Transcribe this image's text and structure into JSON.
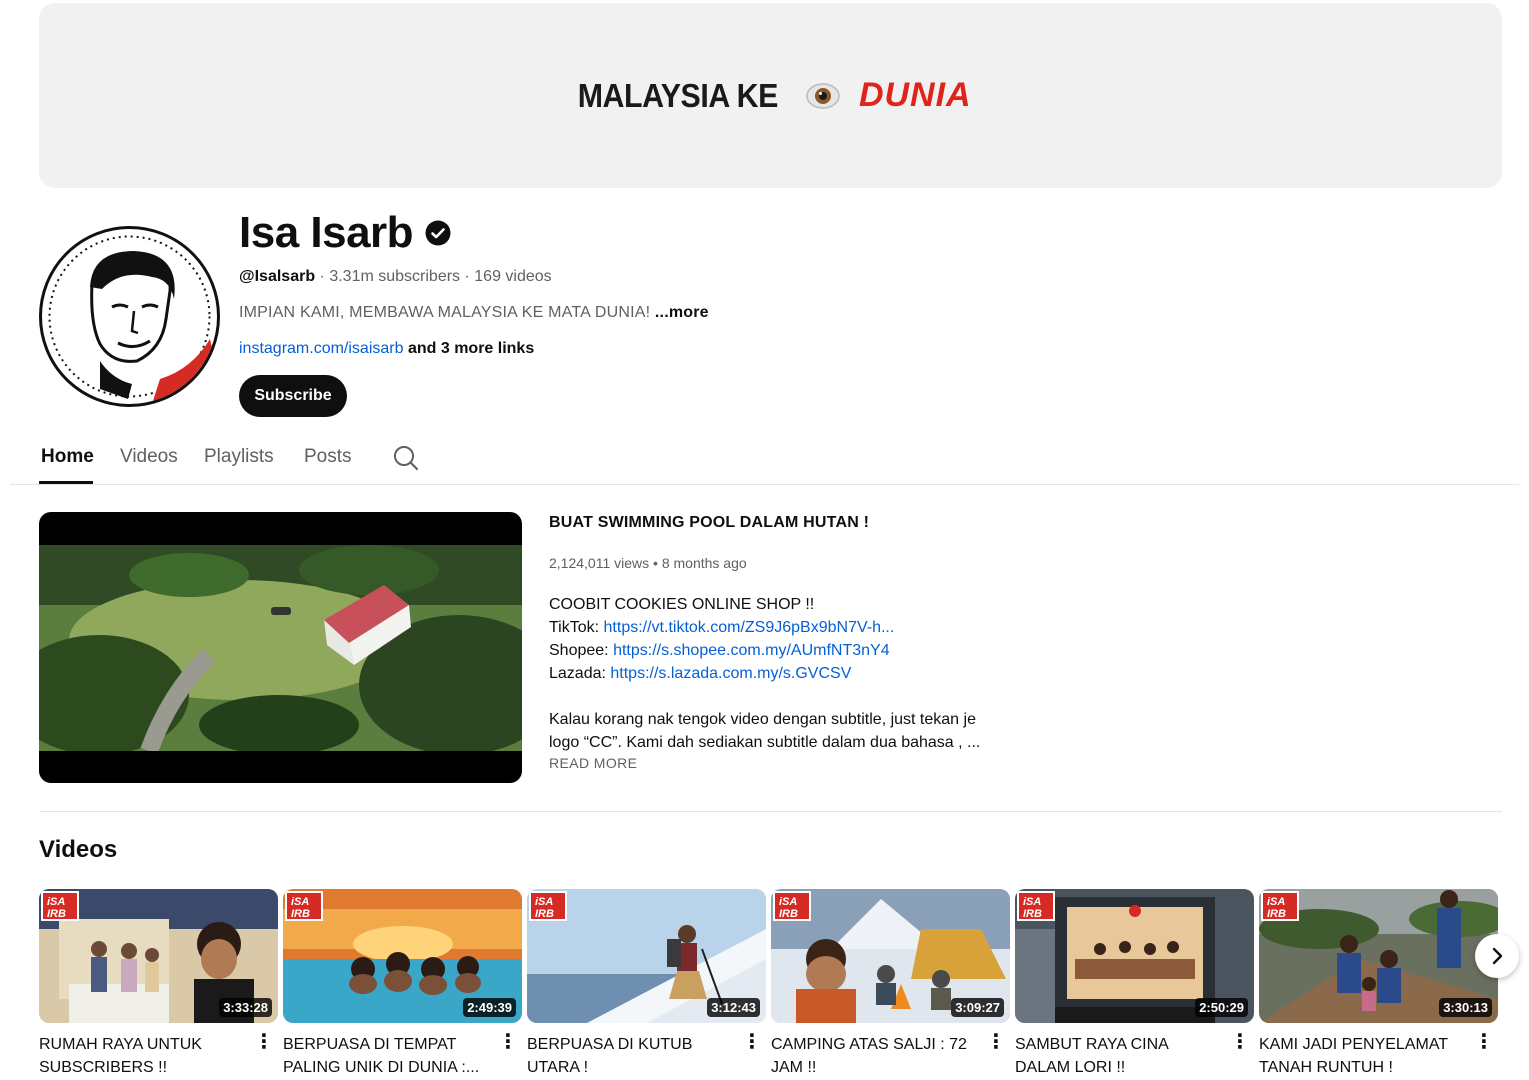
{
  "banner": {
    "left_text": "MALAYSIA KE",
    "right_text": "DUNIA",
    "icon": "eye-icon"
  },
  "channel": {
    "name": "Isa Isarb",
    "verified_icon": "verified-check-icon",
    "handle": "@Isalsarb",
    "subscribers": "3.31m subscribers",
    "videos": "169 videos",
    "description": "IMPIAN KAMI, MEMBAWA MALAYSIA KE MATA DUNIA!",
    "more": "...more",
    "link": "instagram.com/isaisarb",
    "more_links": "and 3 more links",
    "subscribe_label": "Subscribe"
  },
  "tabs": [
    "Home",
    "Videos",
    "Playlists",
    "Posts"
  ],
  "featured": {
    "title": "BUAT SWIMMING POOL DALAM HUTAN !",
    "views": "2,124,011 views",
    "age": "8 months ago",
    "desc_line1": "COOBIT COOKIES ONLINE SHOP !!",
    "tiktok_label": "TikTok:",
    "tiktok_url": "https://vt.tiktok.com/ZS9J6pBx9bN7V-h...",
    "shopee_label": "Shopee:",
    "shopee_url": "https://s.shopee.com.my/AUmfNT3nY4",
    "lazada_label": "Lazada:",
    "lazada_url": "https://s.lazada.com.my/s.GVCSV",
    "desc_para": "Kalau korang nak tengok video dengan subtitle, just tekan je logo “CC”. Kami dah sediakan subtitle dalam dua bahasa , ...",
    "read_more": "READ MORE"
  },
  "shelf": {
    "title": "Videos",
    "badge": "iSA IRB",
    "videos": [
      {
        "title": "RUMAH RAYA UNTUK SUBSCRIBERS !!",
        "duration": "3:33:28"
      },
      {
        "title": "BERPUASA DI TEMPAT PALING UNIK DI DUNIA :...",
        "duration": "2:49:39"
      },
      {
        "title": "BERPUASA DI KUTUB UTARA !",
        "duration": "3:12:43"
      },
      {
        "title": "CAMPING ATAS SALJI : 72 JAM !!",
        "duration": "3:09:27"
      },
      {
        "title": "SAMBUT RAYA CINA DALAM LORI !!",
        "duration": "2:50:29"
      },
      {
        "title": "KAMI JADI PENYELAMAT TANAH RUNTUH !",
        "duration": "3:30:13"
      }
    ]
  }
}
